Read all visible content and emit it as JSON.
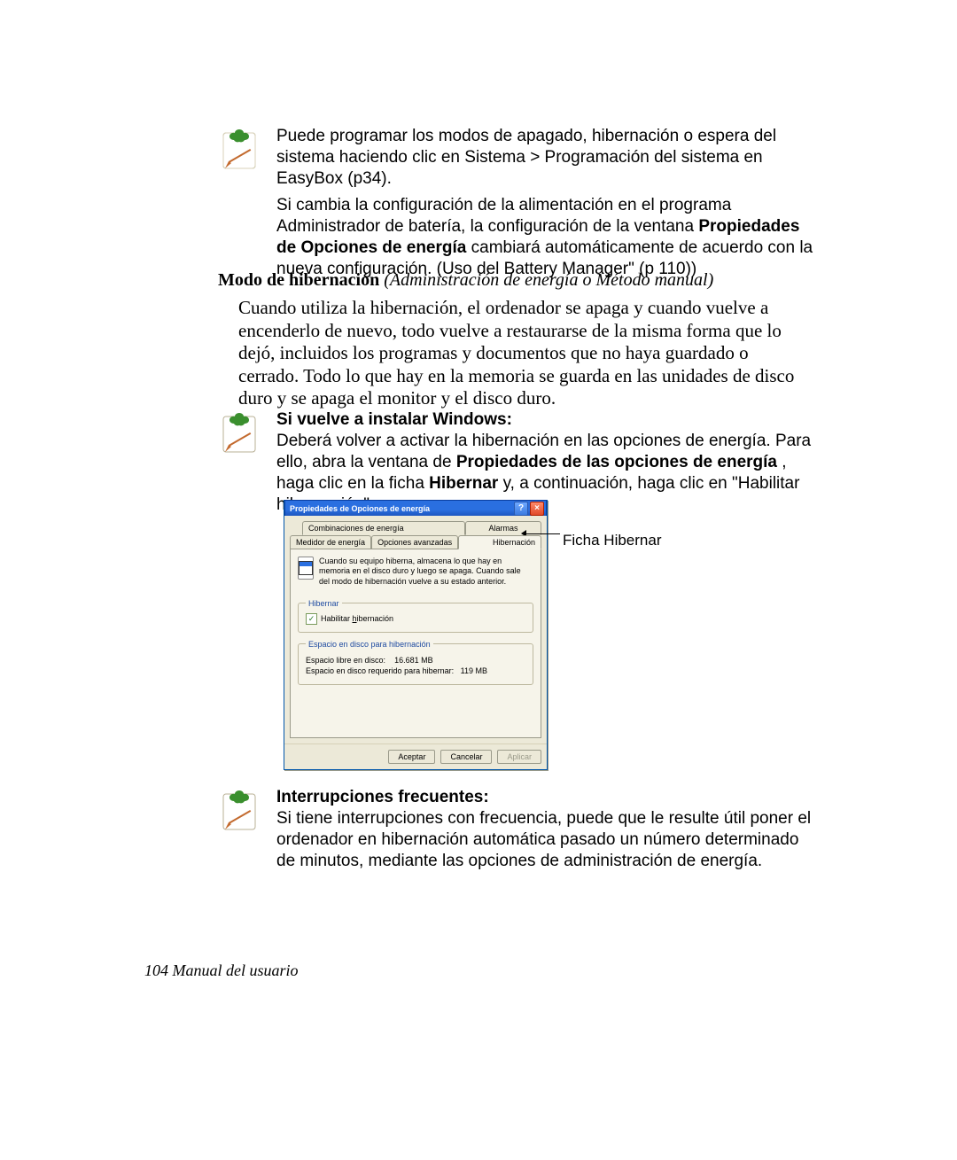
{
  "note1": {
    "p1": "Puede programar los modos de apagado, hibernación o espera del sistema haciendo clic en Sistema > Programación del sistema en EasyBox (p34).",
    "p2a": "Si cambia la configuración de la alimentación en el programa Administrador de batería, la configuración de la ventana ",
    "p2b_bold": "Propiedades de Opciones de energía",
    "p2c": " cambiará automáticamente de acuerdo con la nueva configuración. (Uso del Battery Manager\" (p 110))"
  },
  "section": {
    "title_strong": "Modo de hibernación",
    "title_rest": " (Administración de energía o Método manual)"
  },
  "body": {
    "para": "Cuando utiliza la hibernación, el ordenador se apaga y cuando vuelve a encenderlo de nuevo, todo vuelve a restaurarse de la misma forma que lo dejó, incluidos los programas y documentos que no haya guardado o cerrado. Todo lo que hay en la memoria se guarda en las unidades de disco duro y se apaga el monitor y el disco duro."
  },
  "note2": {
    "head": "Si vuelve a instalar Windows:",
    "p1a": "Deberá volver a activar la hibernación en las opciones de energía. Para ello, abra la ventana de ",
    "p1b_bold": "Propiedades de las opciones de energía",
    "p1c": " , haga clic en la ficha ",
    "p1d_bold": "Hibernar",
    "p1e": " y, a continuación, haga clic en \"Habilitar hibernación\"."
  },
  "dialog": {
    "title": "Propiedades de Opciones de energía",
    "tabs_top": [
      "Combinaciones de energía",
      "Alarmas"
    ],
    "tabs_bottom": [
      "Medidor de energía",
      "Opciones avanzadas",
      "Hibernación"
    ],
    "info_text": "Cuando su equipo hiberna, almacena lo que hay en memoria en el disco duro y luego se apaga. Cuando sale del modo de hibernación vuelve a su estado anterior.",
    "group_hibernar": "Hibernar",
    "chk_label": "Habilitar hibernación",
    "chk_underline": "h",
    "group_espacio": "Espacio en disco para hibernación",
    "kv1_label": "Espacio libre en disco:",
    "kv1_value": "16.681 MB",
    "kv2_label": "Espacio en disco requerido para hibernar:",
    "kv2_value": "119 MB",
    "btn_ok": "Aceptar",
    "btn_cancel": "Cancelar",
    "btn_apply": "Aplicar"
  },
  "callout": "Ficha Hibernar",
  "note3": {
    "head": "Interrupciones frecuentes:",
    "p1": "Si tiene interrupciones con frecuencia, puede que le resulte útil poner el ordenador en hibernación automática pasado un número determinado de minutos, mediante las opciones de administración de energía."
  },
  "footer": "104  Manual del usuario"
}
